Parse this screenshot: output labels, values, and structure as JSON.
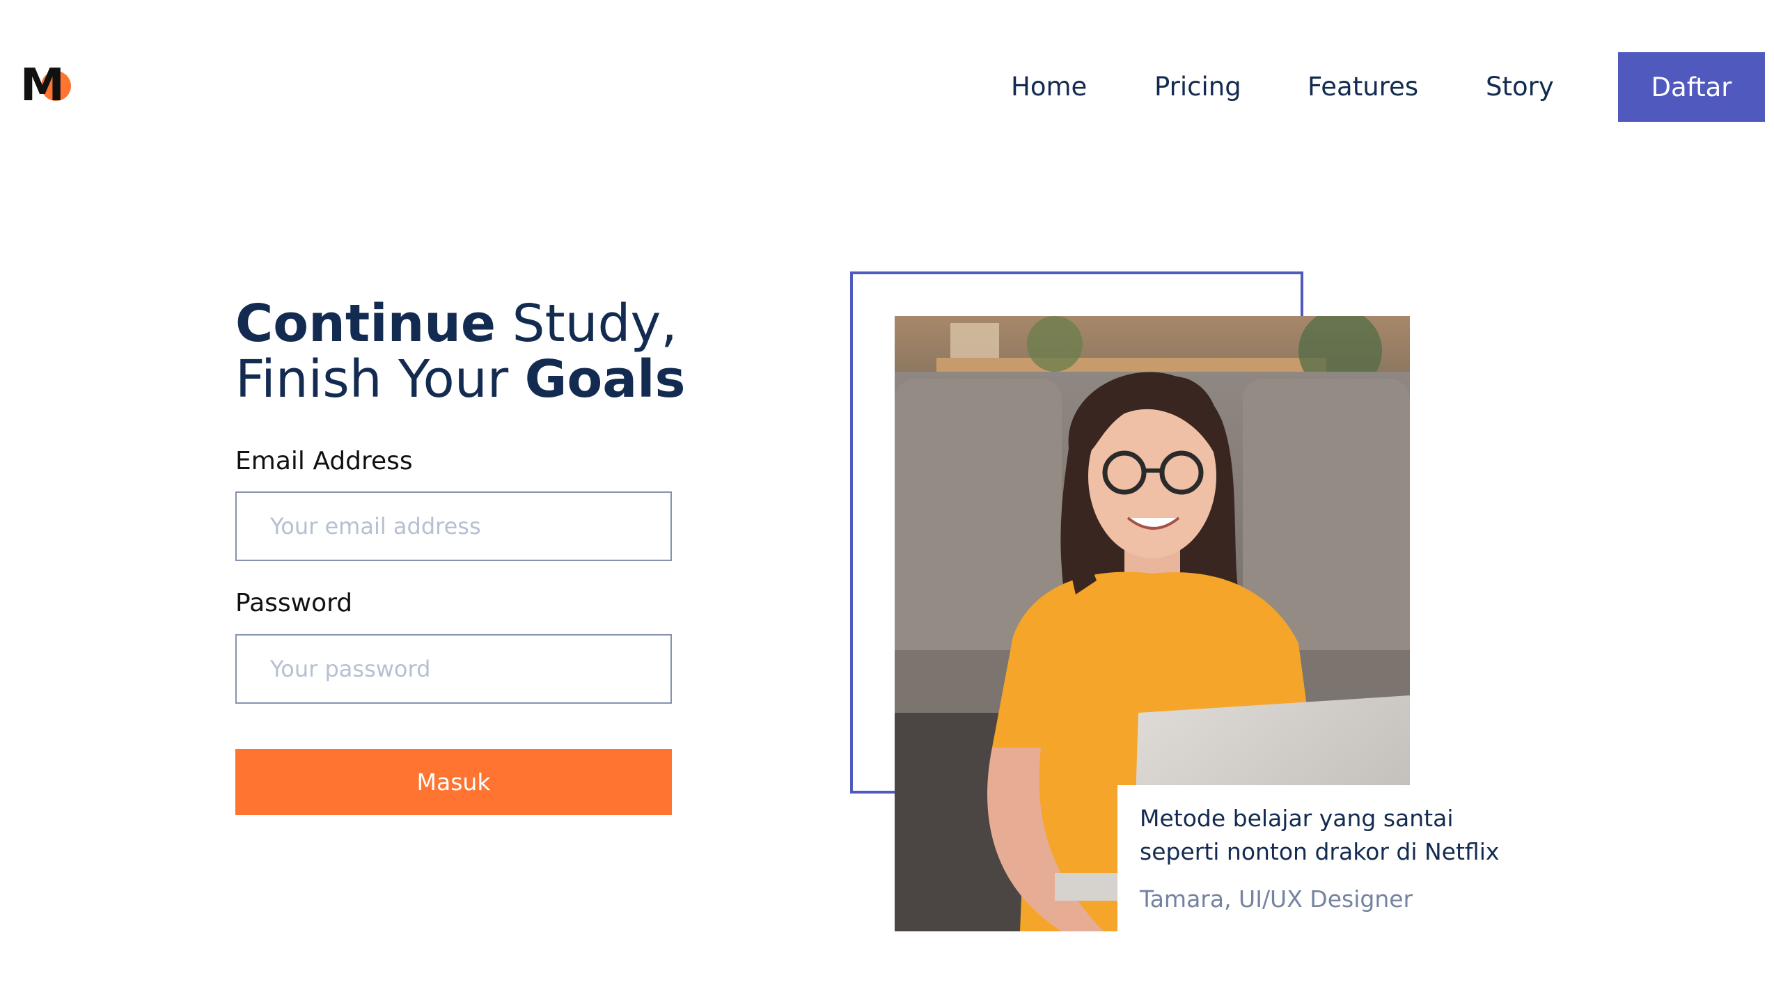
{
  "brand": {
    "logo_letter": "M",
    "colors": {
      "accent_orange": "#FE7430",
      "primary_indigo": "#5059BE",
      "text_navy": "#132B50"
    }
  },
  "nav": {
    "items": [
      {
        "label": "Home"
      },
      {
        "label": "Pricing"
      },
      {
        "label": "Features"
      },
      {
        "label": "Story"
      }
    ],
    "cta_label": "Daftar"
  },
  "hero": {
    "heading": {
      "line1_bold": "Continue",
      "line1_regular": " Study,",
      "line2_regular": "Finish Your ",
      "line2_bold": "Goals"
    }
  },
  "form": {
    "email_label": "Email Address",
    "email_placeholder": "Your email address",
    "email_value": "",
    "password_label": "Password",
    "password_placeholder": "Your password",
    "password_value": "",
    "submit_label": "Masuk"
  },
  "testimonial": {
    "quote": "Metode belajar yang santai seperti nonton drakor di Netflix",
    "author": "Tamara, UI/UX Designer"
  },
  "photo": {
    "icon": "person-with-laptop-photo"
  }
}
